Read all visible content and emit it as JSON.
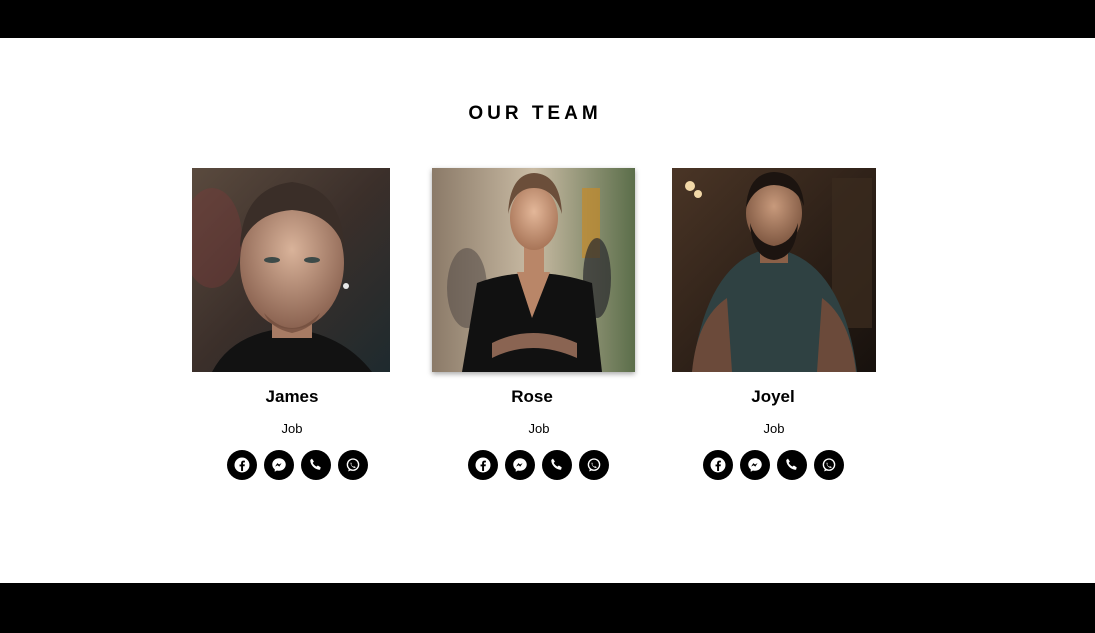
{
  "section": {
    "title": "OUR TEAM"
  },
  "members": [
    {
      "name": "James",
      "job": "Job",
      "photo": "portrait-james"
    },
    {
      "name": "Rose",
      "job": "Job",
      "photo": "portrait-rose"
    },
    {
      "name": "Joyel",
      "job": "Job",
      "photo": "portrait-joyel"
    }
  ],
  "social_icons": [
    "facebook-icon",
    "messenger-icon",
    "phone-icon",
    "whatsapp-icon"
  ],
  "colors": {
    "background": "#ffffff",
    "bars": "#000000",
    "icon_bg": "#000000",
    "icon_fg": "#ffffff"
  }
}
